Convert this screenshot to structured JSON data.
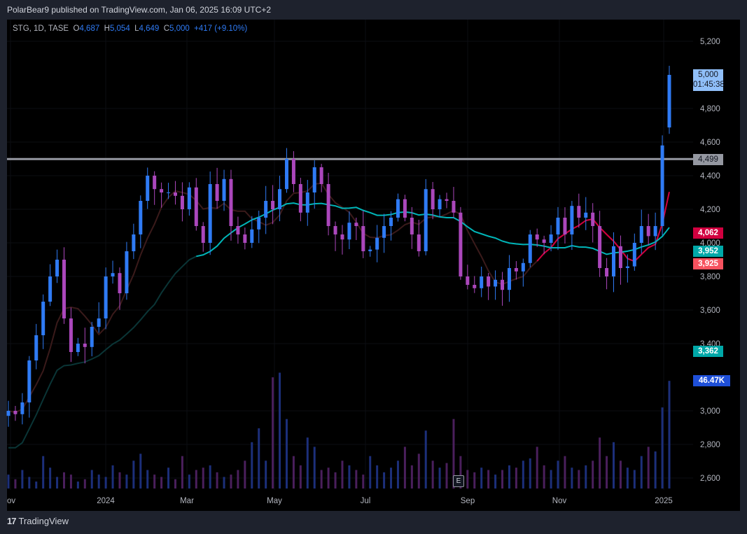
{
  "published": "PolarBear9 published on TradingView.com, Jan 06, 2025 16:09 UTC+2",
  "legend": {
    "symbol": "STG, 1D, TASE",
    "o_label": "O",
    "o": "4,687",
    "h_label": "H",
    "h": "5,054",
    "l_label": "L",
    "l": "4,649",
    "c_label": "C",
    "c": "5,000",
    "change": "+417 (+9.10%)"
  },
  "tags": {
    "last_price": "5,000",
    "countdown": "01:45:38",
    "hline": "4,499",
    "ma_red": "4,062",
    "ma_teal": "3,952",
    "ma_salmon": "3,925",
    "teal2": "3,362",
    "volume": "46.47K"
  },
  "earnings_badge": "E",
  "logo_text": "TradingView",
  "colors": {
    "up": "#2f7bf5",
    "down": "#ab47bc",
    "ma_short": "#3a1a1a",
    "ma_short_active": "#d1003f",
    "ma_long": "#00b5b8",
    "hline": "#9598a1"
  },
  "chart_data": {
    "type": "candlestick",
    "title": "STG, 1D, TASE",
    "y_ticks": [
      "5,200",
      "4,800",
      "4,600",
      "4,400",
      "4,200",
      "4,000",
      "3,800",
      "3,600",
      "3,400",
      "3,000",
      "2,800",
      "2,600"
    ],
    "y_tick_values": [
      5200,
      4800,
      4600,
      4400,
      4200,
      4000,
      3800,
      3600,
      3400,
      3000,
      2800,
      2600
    ],
    "x_ticks": [
      "ov",
      "2024",
      "Mar",
      "May",
      "Jul",
      "Sep",
      "Nov",
      "2025"
    ],
    "ylim": [
      2560,
      5300
    ],
    "horizontal_line": 4499,
    "last_ohlc": {
      "open": 4687,
      "high": 5054,
      "low": 4649,
      "close": 5000
    },
    "closes": [
      3000,
      2980,
      3050,
      3300,
      3450,
      3650,
      3800,
      3900,
      3550,
      3350,
      3400,
      3380,
      3500,
      3550,
      3800,
      3820,
      3700,
      3950,
      4050,
      4250,
      4400,
      4320,
      4300,
      4300,
      4280,
      4200,
      4330,
      4100,
      4000,
      4350,
      4250,
      4380,
      4100,
      4050,
      4000,
      4080,
      4150,
      4250,
      4200,
      4320,
      4500,
      4350,
      4180,
      4300,
      4450,
      4350,
      4100,
      4050,
      4020,
      4120,
      4100,
      3950,
      3960,
      4030,
      4100,
      4150,
      4260,
      4150,
      4050,
      3950,
      4320,
      4200,
      4260,
      4250,
      4180,
      3800,
      3750,
      3730,
      3800,
      3740,
      3780,
      3720,
      3850,
      3830,
      3880,
      4050,
      4020,
      4000,
      4050,
      4150,
      4050,
      4220,
      4150,
      4180,
      4100,
      3850,
      3800,
      3980,
      3850,
      3860,
      4000,
      4100,
      4040,
      4100,
      4580,
      5000
    ],
    "volumes_k": [
      6,
      4,
      8,
      5,
      3,
      14,
      9,
      5,
      7,
      6,
      3,
      4,
      8,
      6,
      5,
      10,
      7,
      6,
      12,
      15,
      8,
      6,
      5,
      9,
      4,
      14,
      6,
      8,
      9,
      10,
      7,
      5,
      6,
      8,
      12,
      20,
      26,
      12,
      48,
      50,
      30,
      14,
      10,
      22,
      18,
      8,
      9,
      7,
      12,
      10,
      8,
      6,
      14,
      10,
      7,
      9,
      12,
      18,
      10,
      15,
      25,
      12,
      9,
      11,
      30,
      14,
      8,
      7,
      9,
      8,
      6,
      8,
      10,
      9,
      12,
      13,
      18,
      10,
      8,
      12,
      14,
      9,
      8,
      10,
      12,
      22,
      14,
      20,
      12,
      9,
      8,
      14,
      18,
      16,
      35,
      46.47
    ]
  }
}
